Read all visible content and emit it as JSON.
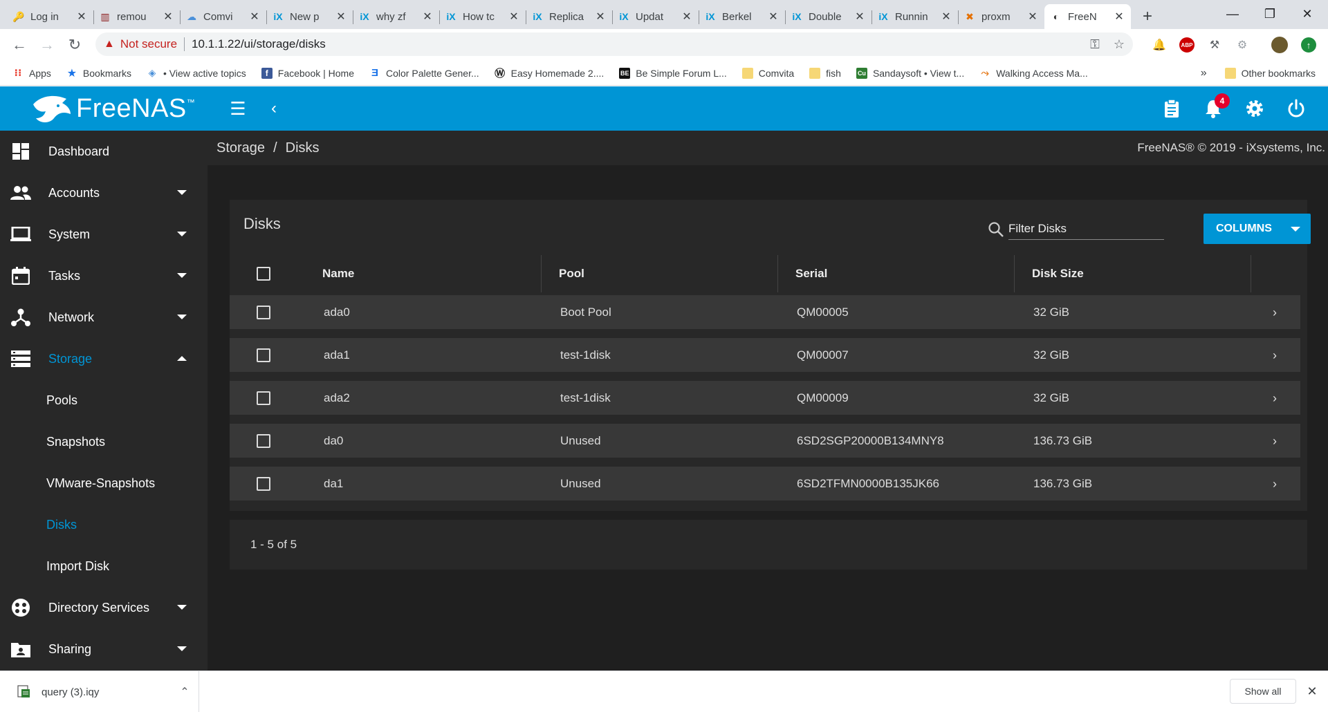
{
  "browser": {
    "tabs": [
      {
        "title": "Log in",
        "icon": "key-icon",
        "active": false
      },
      {
        "title": "remou",
        "icon": "chart-icon",
        "active": false
      },
      {
        "title": "Comvi",
        "icon": "cloud-icon",
        "active": false
      },
      {
        "title": "New p",
        "icon": "ix-icon",
        "active": false
      },
      {
        "title": "why zf",
        "icon": "ix-icon",
        "active": false
      },
      {
        "title": "How tc",
        "icon": "ix-icon",
        "active": false
      },
      {
        "title": "Replica",
        "icon": "ix-icon",
        "active": false
      },
      {
        "title": "Updat",
        "icon": "ix-icon",
        "active": false
      },
      {
        "title": "Berkel",
        "icon": "ix-icon",
        "active": false
      },
      {
        "title": "Double",
        "icon": "ix-icon",
        "active": false
      },
      {
        "title": "Runnin",
        "icon": "ix-icon",
        "active": false
      },
      {
        "title": "proxm",
        "icon": "proxmox-icon",
        "active": false
      },
      {
        "title": "FreeN",
        "icon": "freenas-icon",
        "active": true
      }
    ],
    "not_secure": "Not secure",
    "url": "10.1.1.22/ui/storage/disks",
    "bookmarks": [
      {
        "label": "Apps",
        "icon": "apps-grid-icon"
      },
      {
        "label": "Bookmarks",
        "icon": "star-icon"
      },
      {
        "label": "• View active topics",
        "icon": "diamond-icon"
      },
      {
        "label": "Facebook | Home",
        "icon": "facebook-icon"
      },
      {
        "label": "Color Palette Gener...",
        "icon": "palette-icon"
      },
      {
        "label": "Easy Homemade 2....",
        "icon": "wordpress-icon"
      },
      {
        "label": "Be Simple Forum L...",
        "icon": "be-icon"
      },
      {
        "label": "Comvita",
        "icon": "folder-icon"
      },
      {
        "label": "fish",
        "icon": "folder-icon"
      },
      {
        "label": "Sandaysoft • View t...",
        "icon": "cu-icon"
      },
      {
        "label": "Walking Access Ma...",
        "icon": "walk-icon"
      }
    ],
    "bookmarks_more": "»",
    "other_bookmarks": "Other bookmarks"
  },
  "app": {
    "brand": "FreeNAS",
    "notification_count": "4",
    "colors": {
      "accent": "#0095d5",
      "sidebar": "#282828",
      "content": "#1f1f1f",
      "row": "#383838",
      "badge": "#e4002b"
    }
  },
  "sidebar": {
    "items": [
      {
        "label": "Dashboard",
        "icon": "dashboard-icon",
        "expandable": false
      },
      {
        "label": "Accounts",
        "icon": "accounts-icon",
        "expandable": true
      },
      {
        "label": "System",
        "icon": "laptop-icon",
        "expandable": true
      },
      {
        "label": "Tasks",
        "icon": "calendar-icon",
        "expandable": true
      },
      {
        "label": "Network",
        "icon": "network-icon",
        "expandable": true
      },
      {
        "label": "Storage",
        "icon": "storage-icon",
        "expandable": true,
        "expanded": true
      }
    ],
    "storage_sub": [
      "Pools",
      "Snapshots",
      "VMware-Snapshots",
      "Disks",
      "Import Disk"
    ],
    "lower": [
      {
        "label": "Directory Services",
        "icon": "directory-icon"
      },
      {
        "label": "Sharing",
        "icon": "sharing-icon"
      }
    ]
  },
  "breadcrumb": {
    "parent": "Storage",
    "sep": "/",
    "current": "Disks"
  },
  "copyright": "FreeNAS® © 2019 - iXsystems, Inc.",
  "disks": {
    "title": "Disks",
    "filter_placeholder": "Filter Disks",
    "columns_button": "COLUMNS",
    "headers": [
      "Name",
      "Pool",
      "Serial",
      "Disk Size"
    ],
    "rows": [
      {
        "name": "ada0",
        "pool": "Boot Pool",
        "serial": "QM00005",
        "size": "32 GiB"
      },
      {
        "name": "ada1",
        "pool": "test-1disk",
        "serial": "QM00007",
        "size": "32 GiB"
      },
      {
        "name": "ada2",
        "pool": "test-1disk",
        "serial": "QM00009",
        "size": "32 GiB"
      },
      {
        "name": "da0",
        "pool": "Unused",
        "serial": "6SD2SGP20000B134MNY8",
        "size": "136.73 GiB"
      },
      {
        "name": "da1",
        "pool": "Unused",
        "serial": "6SD2TFMN0000B135JK66",
        "size": "136.73 GiB"
      }
    ],
    "pager": "1 - 5 of 5"
  },
  "downloads": {
    "file": "query (3).iqy",
    "show_all": "Show all"
  }
}
